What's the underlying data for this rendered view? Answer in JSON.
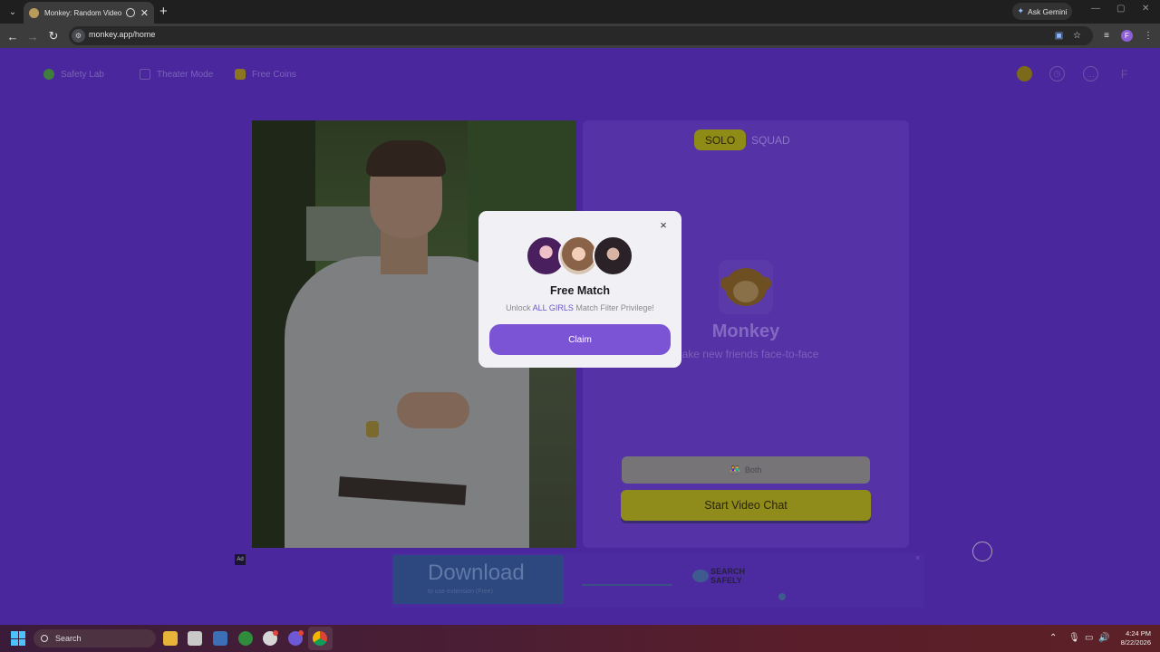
{
  "browser": {
    "tab_title": "Monkey: Random Video Ch",
    "new_tab": "+",
    "ask_gemini": "Ask Gemini",
    "url": "monkey.app/home",
    "profile_initial": "F"
  },
  "page": {
    "topnav": {
      "safety_lab": "Safety Lab",
      "theater_mode": "Theater Mode",
      "free_coins": "Free Coins",
      "profile_initial": "F"
    },
    "panel": {
      "mode_solo": "SOLO",
      "mode_squad": "SQUAD",
      "brand": "Monkey",
      "tagline": "Make new friends face-to-face",
      "gender_filter": "Both",
      "start_button": "Start Video Chat"
    },
    "ad": {
      "label": "Ad",
      "download": "Download",
      "download_sub": "to use extension (Free)",
      "search_line1": "SEARCH",
      "search_line2": "SAFELY",
      "close": "×"
    }
  },
  "modal": {
    "close": "×",
    "title": "Free Match",
    "subtitle_pre": "Unlock ",
    "subtitle_highlight": "ALL GIRLS",
    "subtitle_post": " Match Filter Privilege!",
    "claim_button": "Claim"
  },
  "taskbar": {
    "search_placeholder": "Search",
    "time": "4:24 PM",
    "date": "8/22/2026"
  },
  "colors": {
    "page_bg": "#4a279c",
    "accent_yellow": "#8f8c1b",
    "claim_purple": "#7b54d6",
    "highlight_purple": "#6a58c8"
  }
}
